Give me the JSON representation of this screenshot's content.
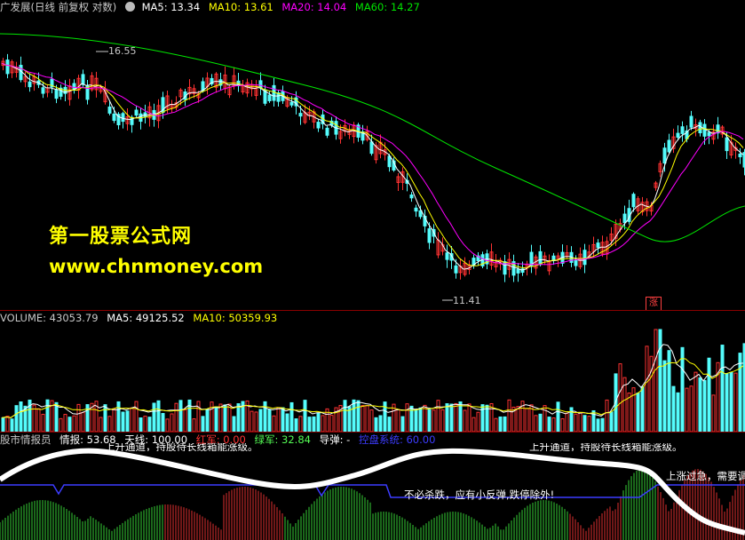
{
  "main_legend": {
    "title": "广发展(日线 前复权 对数)",
    "ma5": "MA5: 13.34",
    "ma10": "MA10: 13.61",
    "ma20": "MA20: 14.04",
    "ma60": "MA60: 14.27"
  },
  "price_labels": {
    "high": "16.55",
    "low": "11.41"
  },
  "watermark": {
    "title": "第一股票公式网",
    "url": "www.chnmoney.com"
  },
  "badge": "涨",
  "volume_legend": {
    "volume": "VOLUME: 43053.79",
    "ma5": "MA5: 49125.52",
    "ma10": "MA10: 50359.93"
  },
  "indicator_legend": {
    "name": "股市情报员",
    "intel": "情报: 53.68",
    "sky": "天线: 100.00",
    "red": "红军: 0.00",
    "green": "绿军: 32.84",
    "guide": "导弹: -",
    "control": "控盘系统: 60.00"
  },
  "indicator_texts": {
    "channel_left": "上升通道，持股待长线箱能涨级。",
    "channel_right": "上升通道，持股待长线箱能涨级。",
    "no_kill": "不必杀跌，应有小反弹,跌停除外!",
    "overheat": "上涨过急，需要调"
  },
  "colors": {
    "up": "#ff3232",
    "down": "#54fcfc",
    "ma5": "#ffffff",
    "ma10": "#ffff00",
    "ma20": "#ff00ff",
    "ma60": "#00e600",
    "divider": "#8a0000"
  },
  "icons": {
    "settings": "gear-icon"
  }
}
